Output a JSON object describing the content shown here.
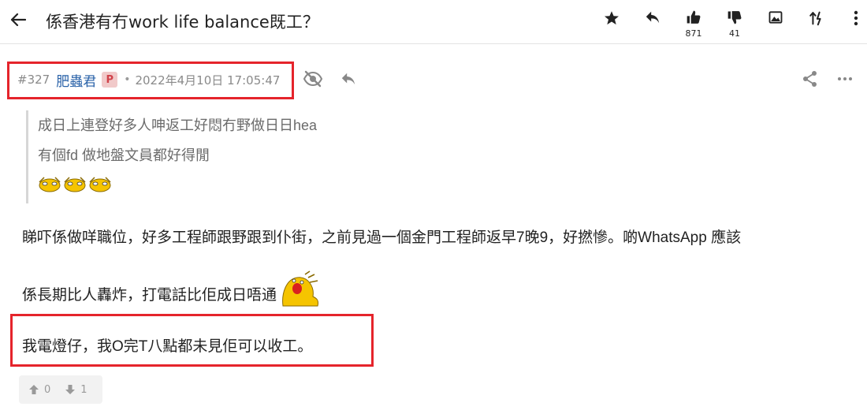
{
  "topbar": {
    "title": "係香港有冇work life balance既工？",
    "like_count": "871",
    "dislike_count": "41"
  },
  "post": {
    "number": "#327",
    "author": "肥蟲君",
    "badge": "P",
    "separator": "•",
    "timestamp": "2022年4月10日 17:05:47",
    "quote": {
      "line1": "成日上連登好多人呻返工好悶冇野做日日hea",
      "line2": "有個fd 做地盤文員都好得閒"
    },
    "body": {
      "line1": "睇吓係做咩職位，好多工程師跟野跟到仆街，之前見過一個金門工程師返早7晚9，好撚慘。啲WhatsApp 應該",
      "line2": "係長期比人轟炸，打電話比佢成日唔通",
      "line3": "我電燈仔，我O完T八點都未見佢可以收工。"
    },
    "votes": {
      "up": "0",
      "down": "1"
    }
  },
  "colors": {
    "highlight": "#e5242b",
    "author": "#2a62a8",
    "badge_bg": "#f1c9c9",
    "badge_fg": "#d0424a"
  },
  "icons": [
    "back-arrow-icon",
    "star-icon",
    "reply-icon",
    "thumbs-up-icon",
    "thumbs-down-icon",
    "image-icon",
    "sort-icon",
    "more-vertical-icon",
    "eye-off-icon",
    "share-icon",
    "more-horizontal-icon",
    "up-arrow-icon",
    "down-arrow-icon",
    "emoji-icon"
  ]
}
